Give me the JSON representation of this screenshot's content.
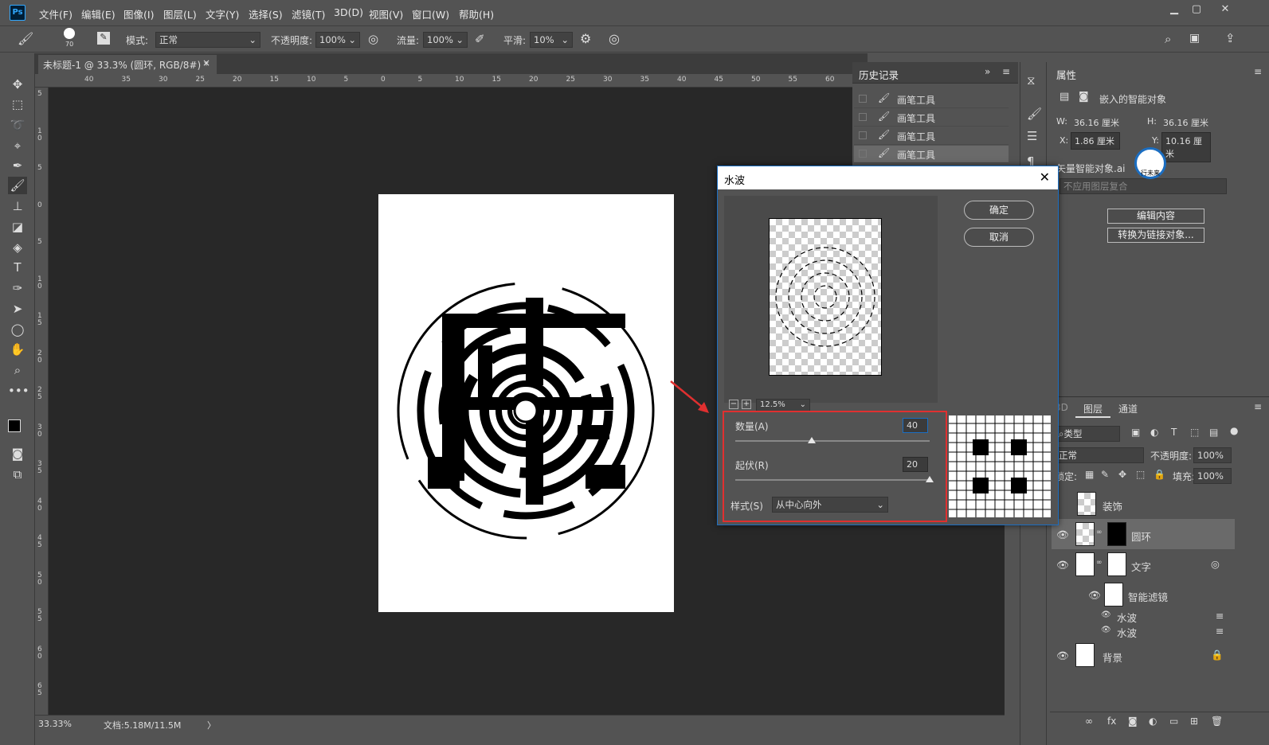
{
  "menubar": {
    "logo": "Ps",
    "items": [
      "文件(F)",
      "编辑(E)",
      "图像(I)",
      "图层(L)",
      "文字(Y)",
      "选择(S)",
      "滤镜(T)",
      "3D(D)",
      "视图(V)",
      "窗口(W)",
      "帮助(H)"
    ],
    "min": "▭",
    "max": "▢",
    "close": "✕"
  },
  "options": {
    "brush_size": "70",
    "mode_label": "模式:",
    "mode_value": "正常",
    "opacity_label": "不透明度:",
    "opacity_value": "100%",
    "flow_label": "流量:",
    "flow_value": "100%",
    "smooth_label": "平滑:",
    "smooth_value": "10%"
  },
  "document_tab": {
    "title": "未标题-1 @ 33.3% (圆环, RGB/8#) *",
    "close": "×"
  },
  "ruler": {
    "h": [
      "40",
      "35",
      "30",
      "25",
      "20",
      "15",
      "10",
      "5",
      "0",
      "5",
      "10",
      "15",
      "20",
      "25",
      "30",
      "35",
      "40",
      "45",
      "50",
      "55",
      "60"
    ],
    "v": [
      "5",
      "1 0",
      "5",
      "0",
      "5",
      "1 0",
      "1 5",
      "2 0",
      "2 5",
      "3 0",
      "3 5",
      "4 0",
      "4 5",
      "5 0",
      "5 5",
      "6 0",
      "6 5"
    ]
  },
  "status": {
    "zoom": "33.33%",
    "doc": "文档:5.18M/11.5M",
    "arrow": "〉"
  },
  "history": {
    "title": "历史记录",
    "items": [
      "画笔工具",
      "画笔工具",
      "画笔工具",
      "画笔工具"
    ]
  },
  "properties": {
    "title": "属性",
    "type": "嵌入的智能对象",
    "w_label": "W:",
    "w_value": "36.16 厘米",
    "h_label": "H:",
    "h_value": "36.16 厘米",
    "x_label": "X:",
    "x_value": "1.86 厘米",
    "y_label": "Y:",
    "y_value": "10.16 厘米",
    "file": "矢量智能对象.ai",
    "comp": "不应用图层复合",
    "edit_btn": "编辑内容",
    "convert_btn": "转换为链接对象..."
  },
  "layers": {
    "tabs": [
      "3D",
      "图层",
      "通道"
    ],
    "filter": "类型",
    "blend": "正常",
    "opacity_label": "不透明度:",
    "opacity_value": "100%",
    "lock_label": "锁定:",
    "fill_label": "填充:",
    "fill_value": "100%",
    "items": [
      "装饰",
      "圆环",
      "文字",
      "智能滤镜",
      "水波",
      "水波",
      "背景"
    ]
  },
  "dialog": {
    "title": "水波",
    "zoom": "12.5%",
    "ok": "确定",
    "cancel": "取消",
    "amount_label": "数量(A)",
    "amount_value": "40",
    "amount": 40,
    "ridges_label": "起伏(R)",
    "ridges_value": "20",
    "ridges": 20,
    "style_label": "样式(S)",
    "style_value": "从中心向外"
  },
  "watermark": {
    "text": "行未来"
  },
  "colors": {
    "accent": "#1b6ec2",
    "highlight": "#e03030"
  }
}
